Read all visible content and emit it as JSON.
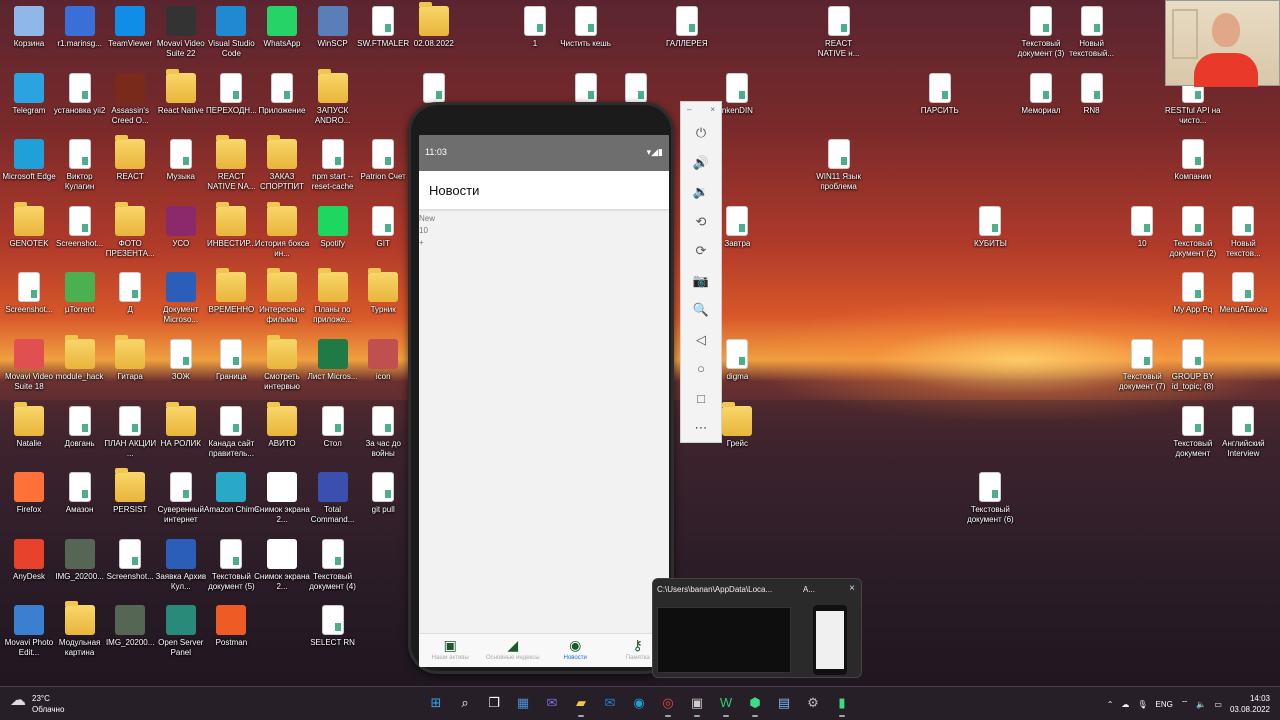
{
  "desktop": {
    "icons": [
      {
        "label": "Корзина",
        "icon": "recycle-bin-icon",
        "color": "#8fb7e8",
        "col": 0,
        "row": 0
      },
      {
        "label": "r1.marinsg...",
        "icon": "computer-icon",
        "color": "#3a6fd8",
        "col": 1,
        "row": 0
      },
      {
        "label": "TeamViewer",
        "icon": "teamviewer-icon",
        "color": "#0e8ee9",
        "col": 2,
        "row": 0
      },
      {
        "label": "Movavi Video Suite 22",
        "icon": "movavi-icon",
        "color": "#333333",
        "col": 3,
        "row": 0
      },
      {
        "label": "Visual Studio Code",
        "icon": "vscode-icon",
        "color": "#1f8ad2",
        "col": 4,
        "row": 0
      },
      {
        "label": "WhatsApp",
        "icon": "whatsapp-icon",
        "color": "#25d366",
        "col": 5,
        "row": 0
      },
      {
        "label": "WinSCP",
        "icon": "winscp-icon",
        "color": "#5a7fb8",
        "col": 6,
        "row": 0
      },
      {
        "label": "SW.FTMALER",
        "icon": "document-icon",
        "color": "#ffffff",
        "col": 7,
        "row": 0
      },
      {
        "label": "02.08.2022",
        "icon": "folder-icon",
        "color": "#f2c94c",
        "col": 8,
        "row": 0
      },
      {
        "label": "1",
        "icon": "document-icon",
        "color": "#ffffff",
        "col": 10,
        "row": 0
      },
      {
        "label": "Чистить кешь",
        "icon": "document-icon",
        "color": "#ffffff",
        "col": 11,
        "row": 0
      },
      {
        "label": "ГАЛЛЕРЕЯ",
        "icon": "document-icon",
        "color": "#ffffff",
        "col": 13,
        "row": 0
      },
      {
        "label": "REACT NATIVE н...",
        "icon": "document-icon",
        "color": "#ffffff",
        "col": 16,
        "row": 0
      },
      {
        "label": "Текстовый документ (3)",
        "icon": "document-icon",
        "color": "#ffffff",
        "col": 20,
        "row": 0
      },
      {
        "label": "Новый текстовый...",
        "icon": "document-icon",
        "color": "#ffffff",
        "col": 21,
        "row": 0
      },
      {
        "label": "Telegram",
        "icon": "telegram-icon",
        "color": "#2aa3e0",
        "col": 0,
        "row": 1
      },
      {
        "label": "установка yii2",
        "icon": "document-icon",
        "color": "#ffffff",
        "col": 1,
        "row": 1
      },
      {
        "label": "Assassin's Creed O...",
        "icon": "game-icon",
        "color": "#7a2a1a",
        "col": 2,
        "row": 1
      },
      {
        "label": "React Native",
        "icon": "folder-icon",
        "color": "#f2c94c",
        "col": 3,
        "row": 1
      },
      {
        "label": "ПЕРЕХОДН...",
        "icon": "document-icon",
        "color": "#ffffff",
        "col": 4,
        "row": 1
      },
      {
        "label": "Приложение",
        "icon": "document-icon",
        "color": "#ffffff",
        "col": 5,
        "row": 1
      },
      {
        "label": "ЗАПУСК ANDRO...",
        "icon": "folder-icon",
        "color": "#f2c94c",
        "col": 6,
        "row": 1
      },
      {
        "label": "",
        "icon": "document-icon",
        "color": "#ffffff",
        "col": 8,
        "row": 1
      },
      {
        "label": "",
        "icon": "document-icon",
        "color": "#ffffff",
        "col": 11,
        "row": 1
      },
      {
        "label": "",
        "icon": "document-icon",
        "color": "#ffffff",
        "col": 12,
        "row": 1
      },
      {
        "label": "nkenDIN",
        "icon": "document-icon",
        "color": "#ffffff",
        "col": 14,
        "row": 1
      },
      {
        "label": "ПАРСИТЬ",
        "icon": "document-icon",
        "color": "#ffffff",
        "col": 18,
        "row": 1
      },
      {
        "label": "Мемориал",
        "icon": "document-icon",
        "color": "#ffffff",
        "col": 20,
        "row": 1
      },
      {
        "label": "RN8",
        "icon": "document-icon",
        "color": "#ffffff",
        "col": 21,
        "row": 1
      },
      {
        "label": "RESTful API на чисто...",
        "icon": "document-icon",
        "color": "#ffffff",
        "col": 23,
        "row": 1
      },
      {
        "label": "Microsoft Edge",
        "icon": "edge-icon",
        "color": "#1fa0d8",
        "col": 0,
        "row": 2
      },
      {
        "label": "Виктор Кулагин",
        "icon": "document-icon",
        "color": "#ffffff",
        "col": 1,
        "row": 2
      },
      {
        "label": "REACT",
        "icon": "folder-icon",
        "color": "#f2c94c",
        "col": 2,
        "row": 2
      },
      {
        "label": "Музыка",
        "icon": "document-icon",
        "color": "#ffffff",
        "col": 3,
        "row": 2
      },
      {
        "label": "REACT NATIVE NA...",
        "icon": "folder-icon",
        "color": "#f2c94c",
        "col": 4,
        "row": 2
      },
      {
        "label": "ЗАКАЗ СПОРТПИТ",
        "icon": "folder-icon",
        "color": "#f2c94c",
        "col": 5,
        "row": 2
      },
      {
        "label": "npm start --reset-cache",
        "icon": "document-icon",
        "color": "#ffffff",
        "col": 6,
        "row": 2
      },
      {
        "label": "Patrion Счет",
        "icon": "document-icon",
        "color": "#ffffff",
        "col": 7,
        "row": 2
      },
      {
        "label": "WIN11 Язык проблема",
        "icon": "document-icon",
        "color": "#ffffff",
        "col": 16,
        "row": 2
      },
      {
        "label": "Компании",
        "icon": "document-icon",
        "color": "#ffffff",
        "col": 23,
        "row": 2
      },
      {
        "label": "GENOTEK",
        "icon": "folder-icon",
        "color": "#f2c94c",
        "col": 0,
        "row": 3
      },
      {
        "label": "Screenshot...",
        "icon": "document-icon",
        "color": "#ffffff",
        "col": 1,
        "row": 3
      },
      {
        "label": "ФОТО ПРЕЗЕНТА...",
        "icon": "folder-icon",
        "color": "#f2c94c",
        "col": 2,
        "row": 3
      },
      {
        "label": "УСО",
        "icon": "winrar-icon",
        "color": "#8a2a6a",
        "col": 3,
        "row": 3
      },
      {
        "label": "ИНВЕСТИР...",
        "icon": "folder-icon",
        "color": "#f2c94c",
        "col": 4,
        "row": 3
      },
      {
        "label": "История бокса ин...",
        "icon": "folder-icon",
        "color": "#f2c94c",
        "col": 5,
        "row": 3
      },
      {
        "label": "Spotify",
        "icon": "spotify-icon",
        "color": "#1ed760",
        "col": 6,
        "row": 3
      },
      {
        "label": "GIT",
        "icon": "document-icon",
        "color": "#ffffff",
        "col": 7,
        "row": 3
      },
      {
        "label": "Завтра",
        "icon": "document-icon",
        "color": "#ffffff",
        "col": 14,
        "row": 3
      },
      {
        "label": "КУБИТЫ",
        "icon": "document-icon",
        "color": "#ffffff",
        "col": 19,
        "row": 3
      },
      {
        "label": "10",
        "icon": "document-icon",
        "color": "#ffffff",
        "col": 22,
        "row": 3
      },
      {
        "label": "Текстовый документ (2)",
        "icon": "document-icon",
        "color": "#ffffff",
        "col": 23,
        "row": 3
      },
      {
        "label": "Новый текстов...",
        "icon": "document-icon",
        "color": "#ffffff",
        "col": 24,
        "row": 3
      },
      {
        "label": "Screenshot...",
        "icon": "document-icon",
        "color": "#ffffff",
        "col": 0,
        "row": 4
      },
      {
        "label": "µTorrent",
        "icon": "utorrent-icon",
        "color": "#4caf50",
        "col": 1,
        "row": 4
      },
      {
        "label": "Д",
        "icon": "document-icon",
        "color": "#ffffff",
        "col": 2,
        "row": 4
      },
      {
        "label": "Документ Microso...",
        "icon": "word-icon",
        "color": "#2b5eb8",
        "col": 3,
        "row": 4
      },
      {
        "label": "ВРЕМЕННО",
        "icon": "folder-icon",
        "color": "#f2c94c",
        "col": 4,
        "row": 4
      },
      {
        "label": "Интересные фильмы",
        "icon": "folder-icon",
        "color": "#f2c94c",
        "col": 5,
        "row": 4
      },
      {
        "label": "Планы по приложе...",
        "icon": "folder-icon",
        "color": "#f2c94c",
        "col": 6,
        "row": 4
      },
      {
        "label": "Турник",
        "icon": "folder-icon",
        "color": "#f2c94c",
        "col": 7,
        "row": 4
      },
      {
        "label": "My App Pq",
        "icon": "document-icon",
        "color": "#ffffff",
        "col": 23,
        "row": 4
      },
      {
        "label": "MenuATavola",
        "icon": "document-icon",
        "color": "#ffffff",
        "col": 24,
        "row": 4
      },
      {
        "label": "Movavi Video Suite 18",
        "icon": "movavi-icon",
        "color": "#e05050",
        "col": 0,
        "row": 5
      },
      {
        "label": "module_hack",
        "icon": "folder-icon",
        "color": "#f2c94c",
        "col": 1,
        "row": 5
      },
      {
        "label": "Гитара",
        "icon": "folder-icon",
        "color": "#f2c94c",
        "col": 2,
        "row": 5
      },
      {
        "label": "ЗОЖ",
        "icon": "document-icon",
        "color": "#ffffff",
        "col": 3,
        "row": 5
      },
      {
        "label": "Граница",
        "icon": "document-icon",
        "color": "#ffffff",
        "col": 4,
        "row": 5
      },
      {
        "label": "Смотреть интервью",
        "icon": "folder-icon",
        "color": "#f2c94c",
        "col": 5,
        "row": 5
      },
      {
        "label": "Лист Micros...",
        "icon": "excel-icon",
        "color": "#1f7a45",
        "col": 6,
        "row": 5
      },
      {
        "label": "icon",
        "icon": "image-icon",
        "color": "#c05050",
        "col": 7,
        "row": 5
      },
      {
        "label": "digma",
        "icon": "document-icon",
        "color": "#ffffff",
        "col": 14,
        "row": 5
      },
      {
        "label": "Текстовый документ (7)",
        "icon": "document-icon",
        "color": "#ffffff",
        "col": 22,
        "row": 5
      },
      {
        "label": "GROUP BY id_topic; (8)",
        "icon": "document-icon",
        "color": "#ffffff",
        "col": 23,
        "row": 5
      },
      {
        "label": "Natalie",
        "icon": "folder-icon",
        "color": "#f2c94c",
        "col": 0,
        "row": 6
      },
      {
        "label": "Довгань",
        "icon": "document-icon",
        "color": "#ffffff",
        "col": 1,
        "row": 6
      },
      {
        "label": "ПЛАН АКЦИИ ...",
        "icon": "document-icon",
        "color": "#ffffff",
        "col": 2,
        "row": 6
      },
      {
        "label": "НА РОЛИК",
        "icon": "folder-icon",
        "color": "#f2c94c",
        "col": 3,
        "row": 6
      },
      {
        "label": "Канада сайт правитель...",
        "icon": "document-icon",
        "color": "#ffffff",
        "col": 4,
        "row": 6
      },
      {
        "label": "АВИТО",
        "icon": "folder-icon",
        "color": "#f2c94c",
        "col": 5,
        "row": 6
      },
      {
        "label": "Стол",
        "icon": "document-icon",
        "color": "#ffffff",
        "col": 6,
        "row": 6
      },
      {
        "label": "За час до войны",
        "icon": "document-icon",
        "color": "#ffffff",
        "col": 7,
        "row": 6
      },
      {
        "label": "Грейс",
        "icon": "folder-icon",
        "color": "#f2c94c",
        "col": 14,
        "row": 6
      },
      {
        "label": "Текстовый документ",
        "icon": "document-icon",
        "color": "#ffffff",
        "col": 23,
        "row": 6
      },
      {
        "label": "Английский Interview",
        "icon": "document-icon",
        "color": "#ffffff",
        "col": 24,
        "row": 6
      },
      {
        "label": "Firefox",
        "icon": "firefox-icon",
        "color": "#ff7139",
        "col": 0,
        "row": 7
      },
      {
        "label": "Амазон",
        "icon": "document-icon",
        "color": "#ffffff",
        "col": 1,
        "row": 7
      },
      {
        "label": "PERSIST",
        "icon": "folder-icon",
        "color": "#f2c94c",
        "col": 2,
        "row": 7
      },
      {
        "label": "Суверенный интернет",
        "icon": "document-icon",
        "color": "#ffffff",
        "col": 3,
        "row": 7
      },
      {
        "label": "Amazon Chime",
        "icon": "chime-icon",
        "color": "#2aa8c8",
        "col": 4,
        "row": 7
      },
      {
        "label": "Снимок экрана 2...",
        "icon": "image-icon",
        "color": "#ffffff",
        "col": 5,
        "row": 7
      },
      {
        "label": "Total Command...",
        "icon": "floppy-icon",
        "color": "#3a4fb0",
        "col": 6,
        "row": 7
      },
      {
        "label": "git pull",
        "icon": "document-icon",
        "color": "#ffffff",
        "col": 7,
        "row": 7
      },
      {
        "label": "Текстовый документ (6)",
        "icon": "document-icon",
        "color": "#ffffff",
        "col": 19,
        "row": 7
      },
      {
        "label": "AnyDesk",
        "icon": "anydesk-icon",
        "color": "#e8412c",
        "col": 0,
        "row": 8
      },
      {
        "label": "IMG_20200...",
        "icon": "image-icon",
        "color": "#556655",
        "col": 1,
        "row": 8
      },
      {
        "label": "Screenshot...",
        "icon": "document-icon",
        "color": "#ffffff",
        "col": 2,
        "row": 8
      },
      {
        "label": "Заявка Архив Кул...",
        "icon": "word-icon",
        "color": "#2b5eb8",
        "col": 3,
        "row": 8
      },
      {
        "label": "Текстовый документ (5)",
        "icon": "document-icon",
        "color": "#ffffff",
        "col": 4,
        "row": 8
      },
      {
        "label": "Снимок экрана 2...",
        "icon": "image-icon",
        "color": "#ffffff",
        "col": 5,
        "row": 8
      },
      {
        "label": "Текстовый документ (4)",
        "icon": "document-icon",
        "color": "#ffffff",
        "col": 6,
        "row": 8
      },
      {
        "label": "Movavi Photo Edit...",
        "icon": "movavi-icon",
        "color": "#3a7fd0",
        "col": 0,
        "row": 9
      },
      {
        "label": "Модульная картина",
        "icon": "folder-icon",
        "color": "#f2c94c",
        "col": 1,
        "row": 9
      },
      {
        "label": "IMG_20200...",
        "icon": "image-icon",
        "color": "#556655",
        "col": 2,
        "row": 9
      },
      {
        "label": "Open Server Panel",
        "icon": "openserver-icon",
        "color": "#2a8a7a",
        "col": 3,
        "row": 9
      },
      {
        "label": "Postman",
        "icon": "postman-icon",
        "color": "#ef5b25",
        "col": 4,
        "row": 9
      },
      {
        "label": "SELECT RN",
        "icon": "document-icon",
        "color": "#ffffff",
        "col": 6,
        "row": 9
      }
    ]
  },
  "emulator": {
    "status_time": "11:03",
    "app_title": "Новости",
    "content_lines": [
      "New",
      "10",
      "+"
    ],
    "tabs": [
      {
        "label": "Наши активы",
        "icon": "money-icon",
        "active": false
      },
      {
        "label": "Основные индексы",
        "icon": "chart-icon",
        "active": false
      },
      {
        "label": "Новости",
        "icon": "news-icon",
        "active": true
      },
      {
        "label": "Памятка",
        "icon": "key-icon",
        "active": false
      }
    ],
    "toolbar": {
      "minimize": "–",
      "close": "×",
      "buttons": [
        {
          "name": "power-icon",
          "glyph": "⏻"
        },
        {
          "name": "volume-up-icon",
          "glyph": "🔊"
        },
        {
          "name": "volume-down-icon",
          "glyph": "🔉"
        },
        {
          "name": "rotate-left-icon",
          "glyph": "⟲"
        },
        {
          "name": "rotate-right-icon",
          "glyph": "⟳"
        },
        {
          "name": "camera-icon",
          "glyph": "📷"
        },
        {
          "name": "zoom-icon",
          "glyph": "🔍"
        },
        {
          "name": "back-icon",
          "glyph": "◁"
        },
        {
          "name": "home-icon",
          "glyph": "○"
        },
        {
          "name": "overview-icon",
          "glyph": "□"
        },
        {
          "name": "more-icon",
          "glyph": "⋯"
        }
      ]
    }
  },
  "thumbnails": {
    "window1_title": "C:\\Users\\banan\\AppData\\Loca...",
    "window2_title": "A...",
    "close": "×"
  },
  "taskbar": {
    "weather_temp": "23°C",
    "weather_desc": "Облачно",
    "language": "ENG",
    "time": "14:03",
    "date": "03.08.2022",
    "apps": [
      {
        "name": "start-icon",
        "glyph": "⊞",
        "color": "#3aa0f0",
        "running": false
      },
      {
        "name": "search-icon",
        "glyph": "⌕",
        "color": "#ffffff",
        "running": false
      },
      {
        "name": "task-view-icon",
        "glyph": "❐",
        "color": "#ffffff",
        "running": false
      },
      {
        "name": "widgets-icon",
        "glyph": "▦",
        "color": "#4a90d9",
        "running": false
      },
      {
        "name": "teams-chat-icon",
        "glyph": "✉",
        "color": "#7b6fd8",
        "running": false
      },
      {
        "name": "file-explorer-icon",
        "glyph": "▰",
        "color": "#f2c94c",
        "running": true
      },
      {
        "name": "mail-icon",
        "glyph": "✉",
        "color": "#2b7cd3",
        "running": false
      },
      {
        "name": "edge-icon",
        "glyph": "◉",
        "color": "#1fa0d8",
        "running": false
      },
      {
        "name": "chrome-icon",
        "glyph": "◎",
        "color": "#e8453c",
        "running": true
      },
      {
        "name": "app-window-icon",
        "glyph": "▣",
        "color": "#cccccc",
        "running": true
      },
      {
        "name": "webstorm-icon",
        "glyph": "W",
        "color": "#2ecc71",
        "running": true
      },
      {
        "name": "android-studio-icon",
        "glyph": "⬢",
        "color": "#3ddc84",
        "running": true
      },
      {
        "name": "notepad-icon",
        "glyph": "▤",
        "color": "#7ab8e8",
        "running": false
      },
      {
        "name": "settings-icon",
        "glyph": "⚙",
        "color": "#bbbbbb",
        "running": false
      },
      {
        "name": "emulator-icon",
        "glyph": "▮",
        "color": "#3ddc84",
        "running": true
      }
    ]
  }
}
